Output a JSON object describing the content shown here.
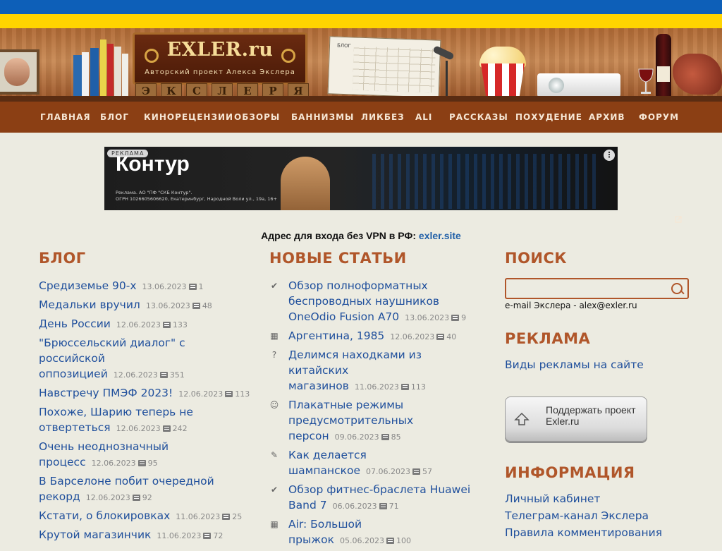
{
  "header": {
    "logo_title": "EXLER.ru",
    "logo_subtitle": "Авторский проект Алекса Экслера",
    "calendar_label": "БЛОГ",
    "letter_tiles": [
      "Э",
      "К",
      "С",
      "Л",
      "Е",
      "Р",
      "Я"
    ]
  },
  "nav": {
    "items": [
      "ГЛАВНАЯ",
      "БЛОГ",
      "КИНОРЕЦЕНЗИИ",
      "ОБЗОРЫ",
      "БАННИЗМЫ",
      "ЛИКБЕЗ",
      "ALI",
      "РАССКАЗЫ",
      "ПОХУДЕНИЕ",
      "АРХИВ",
      "ФОРУМ"
    ],
    "external_icon": "external-link-icon"
  },
  "ad": {
    "badge": "РЕКЛАМА",
    "brand": "Контур",
    "legal_line1": "Реклама. АО \"ПФ \"СКБ Контур\".",
    "legal_line2": "ОГРН 1026605606620, Екатеринбург, Народной Воли ул., 19а, 16+",
    "menu_icon": "more-options-icon"
  },
  "vpn": {
    "prefix": "Адрес для входа без VPN в РФ:",
    "link": "exler.site"
  },
  "blog": {
    "heading": "БЛОГ",
    "items": [
      {
        "title": "Средиземье 90-х",
        "date": "13.06.2023",
        "comments": "1"
      },
      {
        "title": "Медальки вручил",
        "date": "13.06.2023",
        "comments": "48"
      },
      {
        "title": "День России",
        "date": "12.06.2023",
        "comments": "133"
      },
      {
        "title": "\"Брюссельский диалог\" с российской оппозицией",
        "date": "12.06.2023",
        "comments": "351"
      },
      {
        "title": "Навстречу ПМЭФ 2023!",
        "date": "12.06.2023",
        "comments": "113"
      },
      {
        "title": "Похоже, Шарию теперь не отвертеться",
        "date": "12.06.2023",
        "comments": "242"
      },
      {
        "title": "Очень неоднозначный процесс",
        "date": "12.06.2023",
        "comments": "95"
      },
      {
        "title": "В Барселоне побит очередной рекорд",
        "date": "12.06.2023",
        "comments": "92"
      },
      {
        "title": "Кстати, о блокировках",
        "date": "11.06.2023",
        "comments": "25"
      },
      {
        "title": "Крутой магазинчик",
        "date": "11.06.2023",
        "comments": "72"
      }
    ]
  },
  "articles": {
    "heading": "НОВЫЕ СТАТЬИ",
    "items": [
      {
        "icon": "review-icon",
        "glyph": "✔",
        "title": "Обзор полноформатных беспроводных наушников OneOdio Fusion A70",
        "date": "13.06.2023",
        "comments": "9"
      },
      {
        "icon": "movie-icon",
        "glyph": "▦",
        "title": "Аргентина, 1985",
        "date": "12.06.2023",
        "comments": "40"
      },
      {
        "icon": "question-icon",
        "glyph": "?",
        "title": "Делимся находками из китайских магазинов",
        "date": "11.06.2023",
        "comments": "113"
      },
      {
        "icon": "smile-icon",
        "glyph": "☺",
        "title": "Плакатные режимы предусмотрительных персон",
        "date": "09.06.2023",
        "comments": "85"
      },
      {
        "icon": "pencil-icon",
        "glyph": "✎",
        "title": "Как делается шампанское",
        "date": "07.06.2023",
        "comments": "57"
      },
      {
        "icon": "review-icon",
        "glyph": "✔",
        "title": "Обзор фитнес-браслета Huawei Band 7",
        "date": "06.06.2023",
        "comments": "71"
      },
      {
        "icon": "movie-icon",
        "glyph": "▦",
        "title": "Air: Большой прыжок",
        "date": "05.06.2023",
        "comments": "100"
      }
    ]
  },
  "sidebar": {
    "search_heading": "ПОИСК",
    "search_placeholder": "",
    "email_line": "e-mail Экслера - alex@exler.ru",
    "ads_heading": "РЕКЛАМА",
    "ads_link": "Виды рекламы на сайте",
    "support_label": "Поддержать проект Exler.ru",
    "info_heading": "ИНФОРМАЦИЯ",
    "info_links": [
      "Личный кабинет",
      "Телеграм-канал Экслера",
      "Правила комментирования"
    ]
  },
  "colors": {
    "flag_blue": "#0d5fb8",
    "flag_yellow": "#ffd400",
    "nav_bg": "#8b3f14",
    "heading": "#b0562a",
    "link": "#1f4f9c",
    "page_bg": "#ecebe1"
  }
}
